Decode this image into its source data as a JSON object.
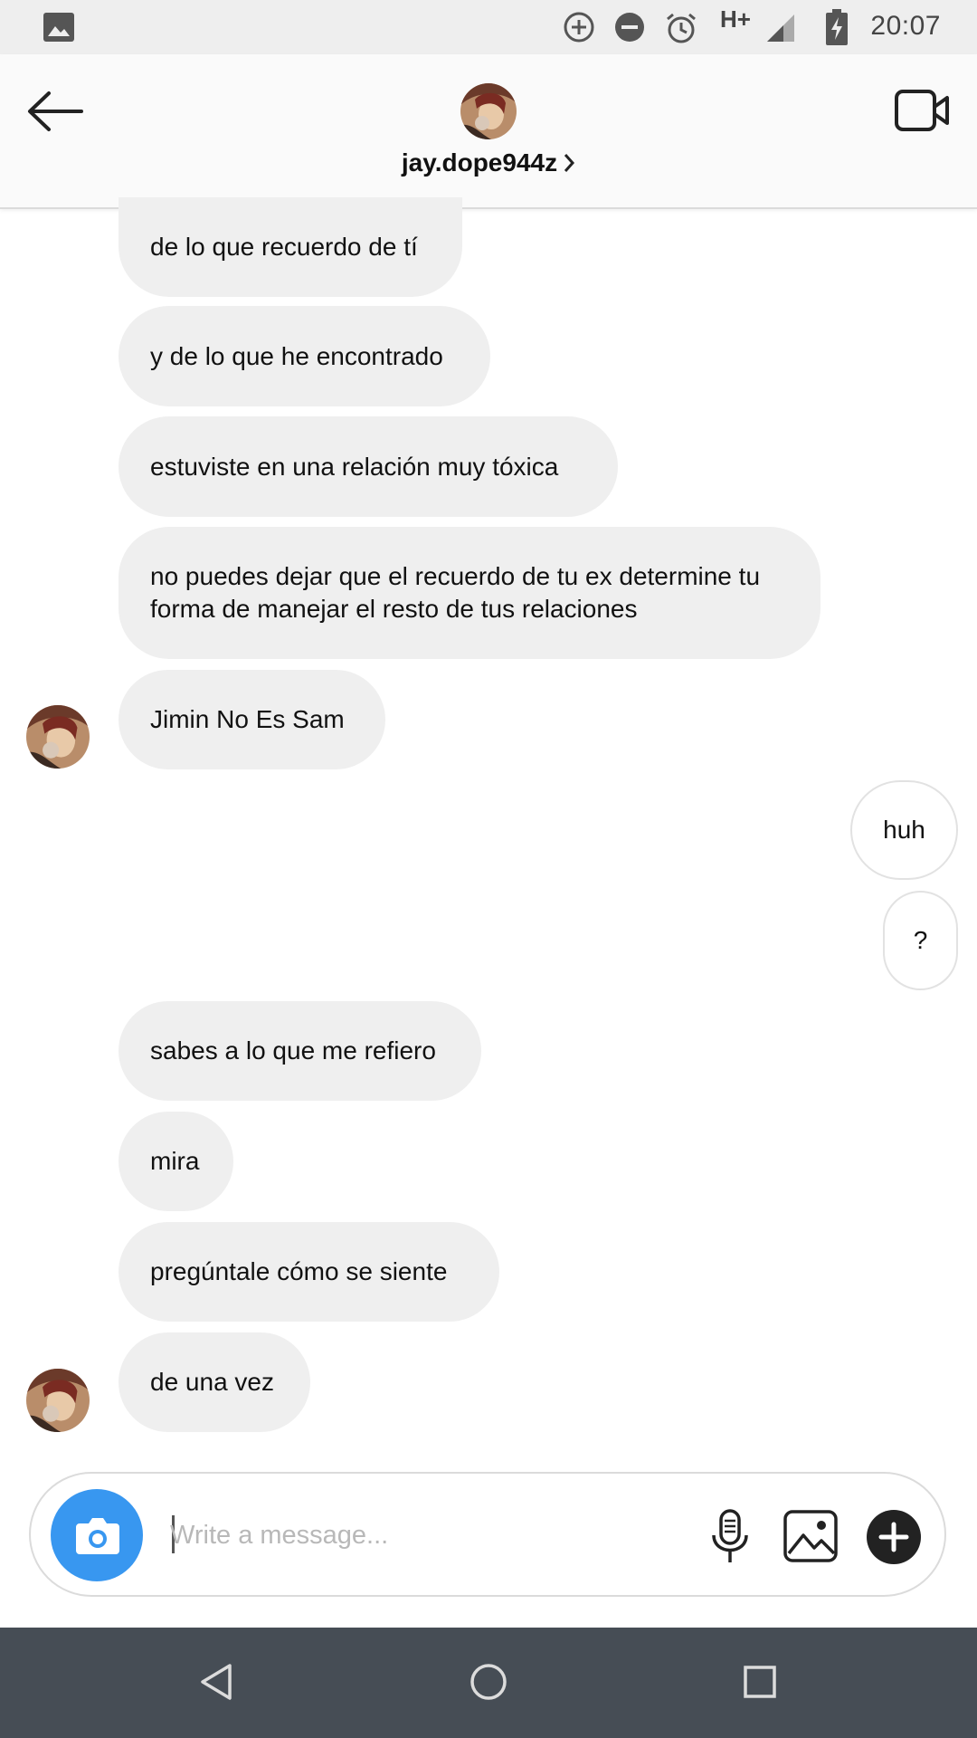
{
  "status_bar": {
    "time": "20:07",
    "network": "H+",
    "icons": [
      "gallery-icon",
      "data-saver-icon",
      "do-not-disturb-icon",
      "alarm-icon",
      "signal-icon",
      "battery-charging-icon"
    ]
  },
  "header": {
    "username": "jay.dope944z",
    "icons": [
      "back-arrow-icon",
      "video-call-icon",
      "chevron-right-icon"
    ]
  },
  "messages": [
    {
      "from": "them",
      "text": "de lo que recuerdo de tí"
    },
    {
      "from": "them",
      "text": "y de lo que he encontrado"
    },
    {
      "from": "them",
      "text": "estuviste en una relación muy tóxica"
    },
    {
      "from": "them",
      "text": "no puedes dejar que el recuerdo de tu ex determine tu forma de manejar el resto de tus relaciones"
    },
    {
      "from": "them",
      "text": "Jimin No Es Sam"
    },
    {
      "from": "me",
      "text": "huh"
    },
    {
      "from": "me",
      "text": "?"
    },
    {
      "from": "them",
      "text": "sabes a lo que me refiero"
    },
    {
      "from": "them",
      "text": "mira"
    },
    {
      "from": "them",
      "text": "pregúntale cómo se siente"
    },
    {
      "from": "them",
      "text": "de una vez"
    }
  ],
  "composer": {
    "placeholder": "Write a message...",
    "value": "",
    "icons": [
      "camera-icon",
      "microphone-icon",
      "gallery-icon",
      "plus-icon"
    ]
  },
  "nav_bar": {
    "icons": [
      "back-triangle-icon",
      "home-circle-icon",
      "recents-square-icon"
    ]
  },
  "colors": {
    "accent": "#3897f0",
    "bubble_received": "#efefef",
    "nav_bar": "#464d55"
  }
}
